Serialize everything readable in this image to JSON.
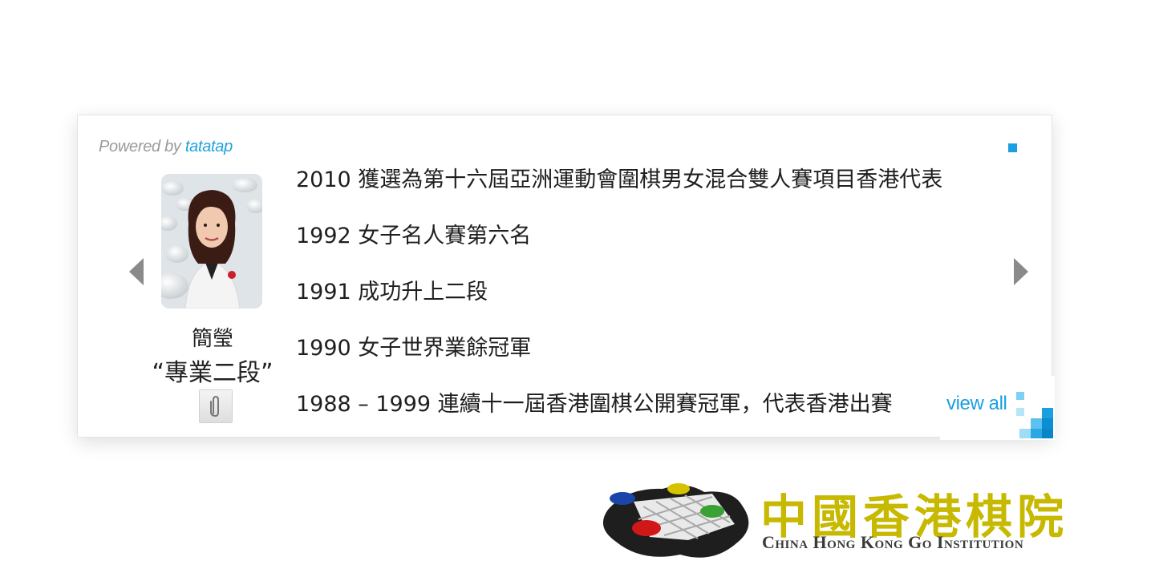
{
  "widget": {
    "powered_prefix": "Powered by",
    "powered_brand": "tatatap",
    "view_all": "view all",
    "accent_color": "#1a9fe0"
  },
  "profile": {
    "name": "簡瑩",
    "title": "“專業二段”"
  },
  "entries": [
    "2010 獲選為第十六屆亞洲運動會圍棋男女混合雙人賽項目香港代表",
    "1992 女子名人賽第六名",
    "1991 成功升上二段",
    "1990 女子世界業餘冠軍",
    "1988 – 1999 連續十一屆香港圍棋公開賽冠軍，代表香港出賽"
  ],
  "logo": {
    "chinese": "中國香港棋院",
    "english": "China Hong Kong Go Institution",
    "primary_color": "#c7b900"
  },
  "icons": {
    "prev": "chevron-left-icon",
    "next": "chevron-right-icon",
    "attachment": "paperclip-icon"
  }
}
